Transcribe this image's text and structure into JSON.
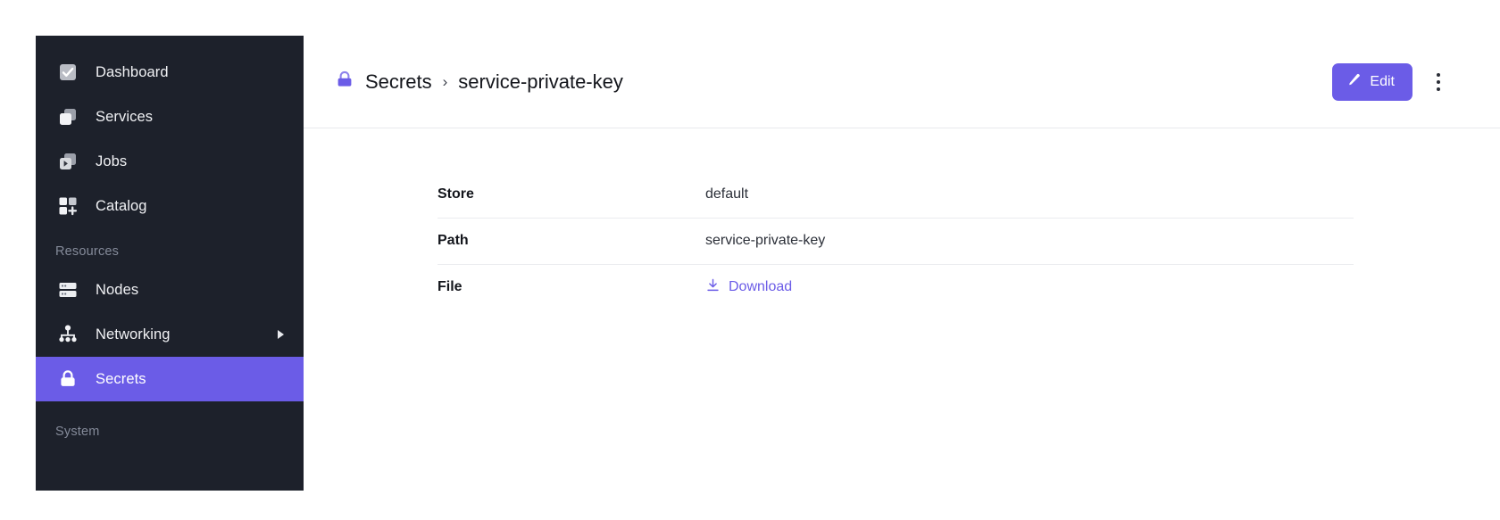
{
  "sidebar": {
    "items": [
      {
        "label": "Dashboard",
        "icon": "dashboard-check-icon",
        "name": "dashboard",
        "active": false,
        "expandable": false
      },
      {
        "label": "Services",
        "icon": "services-stack-icon",
        "name": "services",
        "active": false,
        "expandable": false
      },
      {
        "label": "Jobs",
        "icon": "jobs-play-icon",
        "name": "jobs",
        "active": false,
        "expandable": false
      },
      {
        "label": "Catalog",
        "icon": "catalog-grid-plus-icon",
        "name": "catalog",
        "active": false,
        "expandable": false
      }
    ],
    "resources_section_label": "Resources",
    "resource_items": [
      {
        "label": "Nodes",
        "icon": "nodes-server-icon",
        "name": "nodes",
        "active": false,
        "expandable": false
      },
      {
        "label": "Networking",
        "icon": "networking-tree-icon",
        "name": "networking",
        "active": false,
        "expandable": true
      },
      {
        "label": "Secrets",
        "icon": "secrets-lock-icon",
        "name": "secrets",
        "active": true,
        "expandable": false
      }
    ],
    "system_section_label": "System",
    "active_color": "#6b5ce7",
    "background_color": "#1d212b"
  },
  "header": {
    "breadcrumb": {
      "icon": "lock-icon",
      "root": "Secrets",
      "separator": "›",
      "current": "service-private-key"
    },
    "edit_label": "Edit",
    "edit_icon": "pencil-icon",
    "kebab_icon": "more-vertical-icon",
    "accent_color": "#6b5ce7"
  },
  "main": {
    "rows": [
      {
        "key": "Store",
        "value": "default",
        "type": "text"
      },
      {
        "key": "Path",
        "value": "service-private-key",
        "type": "text"
      },
      {
        "key": "File",
        "value": "Download",
        "type": "link",
        "icon": "download-icon"
      }
    ]
  }
}
